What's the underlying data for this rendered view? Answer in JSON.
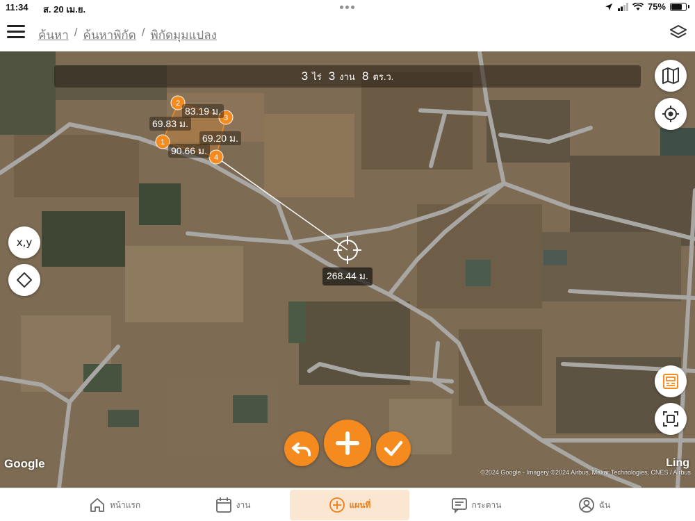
{
  "status_bar": {
    "time": "11:34",
    "date": "ส. 20 เม.ย.",
    "battery": "75%",
    "battery_level": 0.75
  },
  "header": {
    "breadcrumb": [
      "ค้นหา",
      "ค้นหาพิกัด",
      "พิกัดมุมแปลง"
    ],
    "separator": "/"
  },
  "area": {
    "rai_value": "3",
    "rai_unit": "ไร่",
    "ngan_value": "3",
    "ngan_unit": "งาน",
    "wa_value": "8",
    "wa_unit": "ตร.ว."
  },
  "markers": [
    "1",
    "2",
    "3",
    "4"
  ],
  "distances": {
    "d12": "69.83 ม.",
    "d23": "83.19 ม.",
    "d34": "69.20 ม.",
    "d41": "90.66 ม.",
    "cursor": "268.44 ม."
  },
  "buttons": {
    "xy": "x,y"
  },
  "map": {
    "google": "Google",
    "brand": "Ling",
    "attribution": "©2024 Google - Imagery ©2024 Airbus, Maxar Technologies, CNES / Airbus"
  },
  "nav": [
    {
      "label": "หน้าแรก",
      "icon": "home-icon"
    },
    {
      "label": "งาน",
      "icon": "calendar-icon"
    },
    {
      "label": "แผนที่",
      "icon": "plus-circle-icon",
      "active": true
    },
    {
      "label": "กระดาน",
      "icon": "board-icon"
    },
    {
      "label": "ฉัน",
      "icon": "user-icon"
    }
  ],
  "colors": {
    "accent": "#f58a1f",
    "nav_active_bg": "#fbe6d2",
    "road": "#a9a7a3"
  }
}
